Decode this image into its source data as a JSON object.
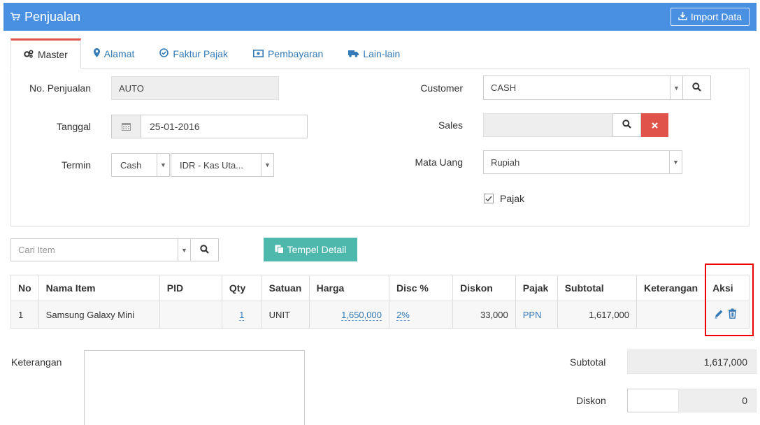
{
  "header": {
    "title": "Penjualan",
    "import_label": "Import Data"
  },
  "tabs": [
    {
      "label": "Master",
      "icon": "cogs-icon"
    },
    {
      "label": "Alamat",
      "icon": "map-marker-icon"
    },
    {
      "label": "Faktur Pajak",
      "icon": "check-circle-icon"
    },
    {
      "label": "Pembayaran",
      "icon": "money-icon"
    },
    {
      "label": "Lain-lain",
      "icon": "truck-icon"
    }
  ],
  "form": {
    "no_penjualan_label": "No. Penjualan",
    "no_penjualan_value": "AUTO",
    "tanggal_label": "Tanggal",
    "tanggal_value": "25-01-2016",
    "termin_label": "Termin",
    "termin_value": "Cash",
    "kas_value": "IDR - Kas Uta...",
    "customer_label": "Customer",
    "customer_value": "CASH",
    "sales_label": "Sales",
    "sales_value": "",
    "mata_uang_label": "Mata Uang",
    "mata_uang_value": "Rupiah",
    "pajak_label": "Pajak",
    "pajak_checked": true
  },
  "search": {
    "placeholder": "Cari Item",
    "tempel_label": "Tempel Detail"
  },
  "table": {
    "headers": [
      "No",
      "Nama Item",
      "PID",
      "Qty",
      "Satuan",
      "Harga",
      "Disc %",
      "Diskon",
      "Pajak",
      "Subtotal",
      "Keterangan",
      "Aksi"
    ],
    "rows": [
      {
        "no": "1",
        "nama": "Samsung Galaxy Mini",
        "pid": "",
        "qty": "1",
        "satuan": "UNIT",
        "harga": "1,650,000",
        "disc": "2%",
        "diskon": "33,000",
        "pajak": "PPN",
        "subtotal": "1,617,000",
        "keterangan": ""
      }
    ]
  },
  "summary": {
    "keterangan_label": "Keterangan",
    "subtotal_label": "Subtotal",
    "subtotal_value": "1,617,000",
    "diskon_label": "Diskon",
    "diskon_value": "0"
  }
}
